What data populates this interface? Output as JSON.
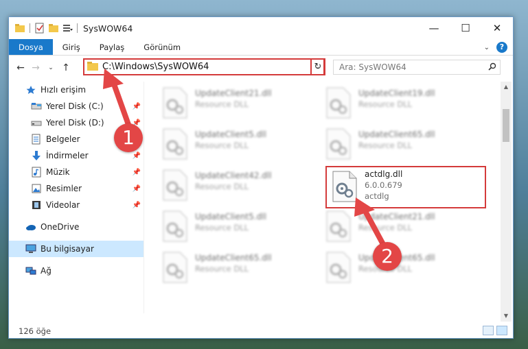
{
  "window": {
    "title": "SysWOW64",
    "controls": {
      "minimize": "—",
      "maximize": "☐",
      "close": "✕"
    }
  },
  "ribbon": {
    "tabs": [
      "Dosya",
      "Giriş",
      "Paylaş",
      "Görünüm"
    ],
    "help": "?"
  },
  "address_bar": {
    "path": "C:\\Windows\\SysWOW64",
    "search_placeholder": "Ara: SysWOW64"
  },
  "nav": {
    "items": [
      {
        "label": "Hızlı erişim",
        "icon": "star-icon",
        "pinned": false
      },
      {
        "label": "Yerel Disk (C:)",
        "icon": "drive-icon",
        "pinned": true
      },
      {
        "label": "Yerel Disk (D:)",
        "icon": "drive-icon",
        "pinned": true
      },
      {
        "label": "Belgeler",
        "icon": "document-icon",
        "pinned": true
      },
      {
        "label": "İndirmeler",
        "icon": "download-icon",
        "pinned": true
      },
      {
        "label": "Müzik",
        "icon": "music-icon",
        "pinned": true
      },
      {
        "label": "Resimler",
        "icon": "pictures-icon",
        "pinned": true
      },
      {
        "label": "Videolar",
        "icon": "video-icon",
        "pinned": true
      },
      {
        "label": "OneDrive",
        "icon": "cloud-icon",
        "pinned": false
      },
      {
        "label": "Bu bilgisayar",
        "icon": "computer-icon",
        "pinned": false,
        "selected": true
      },
      {
        "label": "Ağ",
        "icon": "network-icon",
        "pinned": false
      }
    ]
  },
  "files": [
    {
      "name": "UpdateClient21.dll",
      "sub1": "Resource DLL",
      "sub2": "",
      "blurred": true
    },
    {
      "name": "UpdateClient19.dll",
      "sub1": "Resource DLL",
      "sub2": "",
      "blurred": true
    },
    {
      "name": "UpdateClient5.dll",
      "sub1": "Resource DLL",
      "sub2": "",
      "blurred": true
    },
    {
      "name": "UpdateClient65.dll",
      "sub1": "Resource DLL",
      "sub2": "",
      "blurred": true
    },
    {
      "name": "UpdateClient42.dll",
      "sub1": "Resource DLL",
      "sub2": "",
      "blurred": true
    },
    {
      "name": "actdlg.dll",
      "sub1": "6.0.0.679",
      "sub2": "actdlg",
      "blurred": false
    },
    {
      "name": "UpdateClient5.dll",
      "sub1": "Resource DLL",
      "sub2": "",
      "blurred": true
    },
    {
      "name": "UpdateClient21.dll",
      "sub1": "Resource DLL",
      "sub2": "",
      "blurred": true
    },
    {
      "name": "UpdateClient65.dll",
      "sub1": "Resource DLL",
      "sub2": "",
      "blurred": true
    },
    {
      "name": "UpdateClient65.dll",
      "sub1": "Resource DLL",
      "sub2": "",
      "blurred": true
    }
  ],
  "status": {
    "item_count": "126 öğe"
  },
  "annotations": {
    "badge1": "1",
    "badge2": "2",
    "color": "#e34646"
  }
}
